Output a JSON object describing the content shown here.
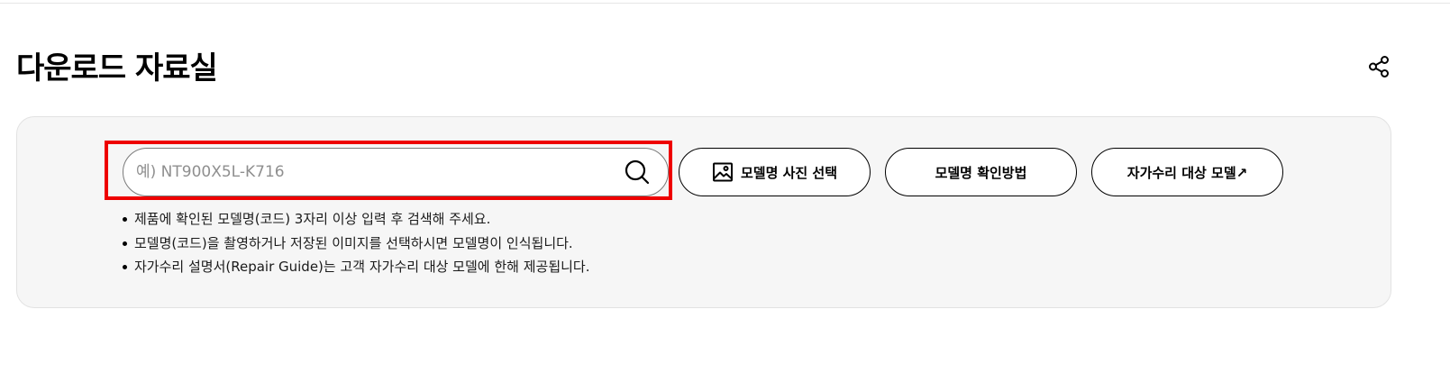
{
  "page": {
    "title": "다운로드 자료실"
  },
  "header": {
    "share_icon": "share-icon"
  },
  "search": {
    "placeholder": "예) NT900X5L-K716",
    "value": "",
    "search_icon": "search-icon",
    "highlight_color": "#ee0000"
  },
  "buttons": {
    "photo_select_label": "모델명 사진 선택",
    "photo_select_icon": "image-icon",
    "check_method_label": "모델명 확인방법",
    "self_repair_label": "자가수리 대상 모델↗"
  },
  "notes": [
    "제품에 확인된 모델명(코드) 3자리 이상 입력 후 검색해 주세요.",
    "모델명(코드)을 촬영하거나 저장된 이미지를 선택하시면 모델명이 인식됩니다.",
    "자가수리 설명서(Repair Guide)는 고객 자가수리 대상 모델에 한해 제공됩니다."
  ]
}
